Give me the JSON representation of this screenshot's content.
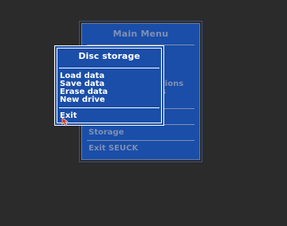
{
  "main_menu": {
    "title": "Main Menu",
    "fragment_1": "tions",
    "fragment_2": "s",
    "items": [
      {
        "label": "Storage"
      },
      {
        "label": "Exit SEUCK"
      }
    ]
  },
  "popup": {
    "title": "Disc storage",
    "items": [
      {
        "label": "Load data"
      },
      {
        "label": "Save data"
      },
      {
        "label": "Erase data"
      },
      {
        "label": "New drive"
      }
    ],
    "exit_label": "Exit"
  },
  "colors": {
    "background": "#2b2b2b",
    "panel": "#1a4ea8",
    "dim_text": "#7f8fb5",
    "text": "#ffffff",
    "cursor": "#e0301e"
  },
  "icons": {
    "cursor": "arrow-cursor-icon"
  }
}
